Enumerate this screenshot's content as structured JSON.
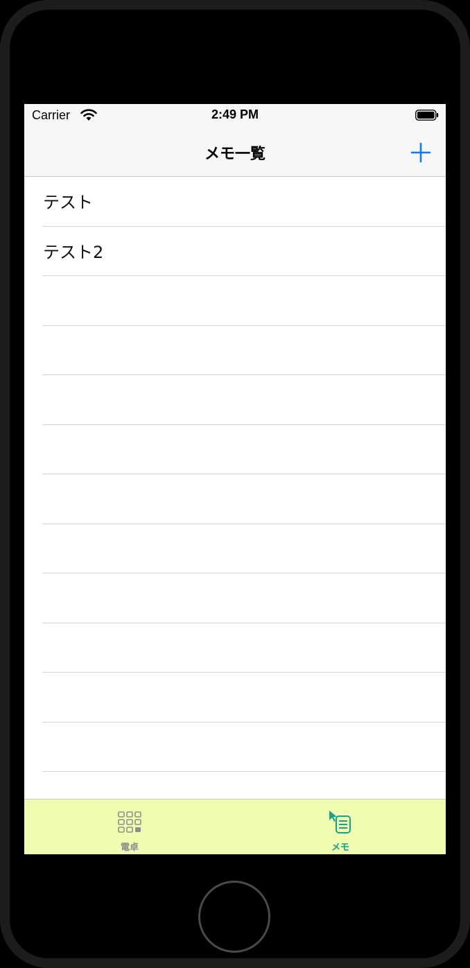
{
  "status_bar": {
    "carrier": "Carrier",
    "time": "2:49 PM"
  },
  "nav": {
    "title": "メモ一覧",
    "add_icon": "plus-icon"
  },
  "memos": [
    {
      "label": "テスト"
    },
    {
      "label": "テスト2"
    },
    {
      "label": ""
    },
    {
      "label": ""
    },
    {
      "label": ""
    },
    {
      "label": ""
    },
    {
      "label": ""
    },
    {
      "label": ""
    },
    {
      "label": ""
    },
    {
      "label": ""
    },
    {
      "label": ""
    },
    {
      "label": ""
    }
  ],
  "tabs": [
    {
      "label": "電卓",
      "icon": "calculator-grid-icon",
      "selected": false
    },
    {
      "label": "メモ",
      "icon": "memo-list-icon",
      "selected": true
    }
  ],
  "colors": {
    "accent": "#0a7aff",
    "tab_selected": "#14a28c",
    "tab_unselected": "#8e8e8e",
    "tabbar_bg": "#f0fdb0"
  }
}
